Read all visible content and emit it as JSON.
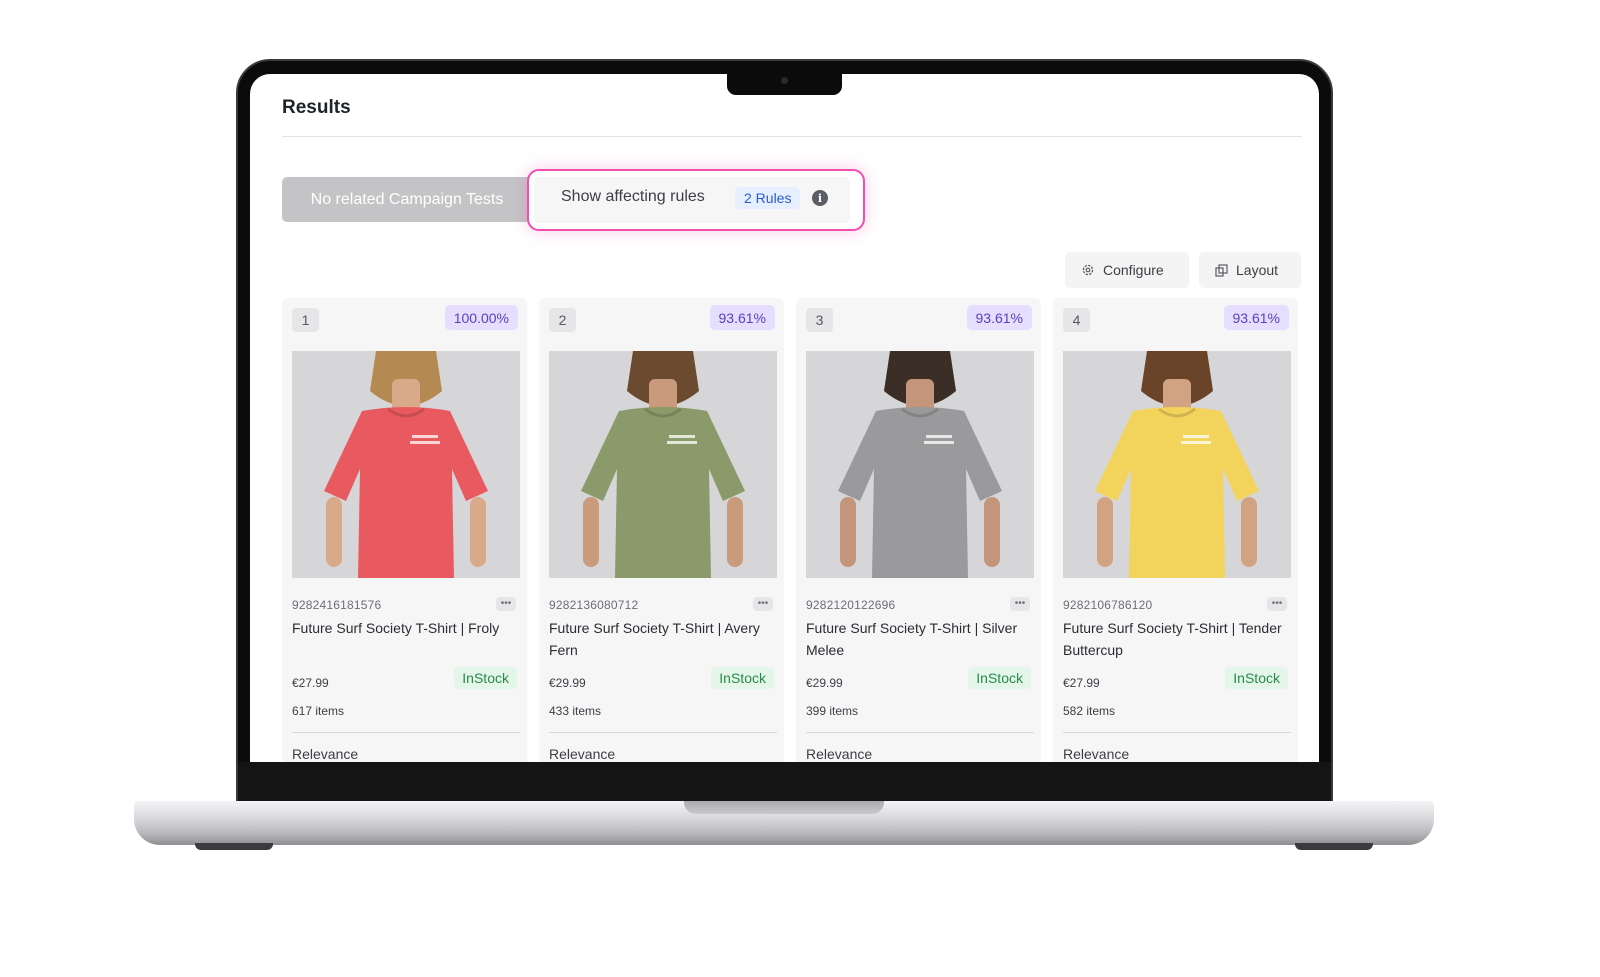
{
  "header": {
    "title": "Results"
  },
  "toolbar": {
    "campaign_label": "No related Campaign Tests",
    "rules_label": "Show affecting rules",
    "rules_badge": "2 Rules",
    "configure_label": "Configure",
    "layout_label": "Layout"
  },
  "colors": {
    "highlight": "#ee4fb0",
    "score_bg": "#e5deff",
    "score_text": "#5a3fc0",
    "instock_bg": "#e4f6ea",
    "instock_text": "#2a8a4a"
  },
  "products": [
    {
      "rank": "1",
      "score": "100.00%",
      "sku": "9282416181576",
      "name": "Future Surf Society T-Shirt | Froly",
      "price": "€27.99",
      "stock": "InStock",
      "items": "617 items",
      "sort": "Relevance",
      "shirt_color": "#e85a60",
      "skin": "#d9a98a",
      "hair": "#b58a52"
    },
    {
      "rank": "2",
      "score": "93.61%",
      "sku": "9282136080712",
      "name": "Future Surf Society T-Shirt | Avery Fern",
      "price": "€29.99",
      "stock": "InStock",
      "items": "433 items",
      "sort": "Relevance",
      "shirt_color": "#8a9a6a",
      "skin": "#c99a7c",
      "hair": "#6b4a30"
    },
    {
      "rank": "3",
      "score": "93.61%",
      "sku": "9282120122696",
      "name": "Future Surf Society T-Shirt | Silver Melee",
      "price": "€29.99",
      "stock": "InStock",
      "items": "399 items",
      "sort": "Relevance",
      "shirt_color": "#9a9a9c",
      "skin": "#c4957a",
      "hair": "#3a2e26"
    },
    {
      "rank": "4",
      "score": "93.61%",
      "sku": "9282106786120",
      "name": "Future Surf Society T-Shirt | Tender Buttercup",
      "price": "€27.99",
      "stock": "InStock",
      "items": "582 items",
      "sort": "Relevance",
      "shirt_color": "#f2d35c",
      "skin": "#d2a383",
      "hair": "#6a4428"
    }
  ]
}
